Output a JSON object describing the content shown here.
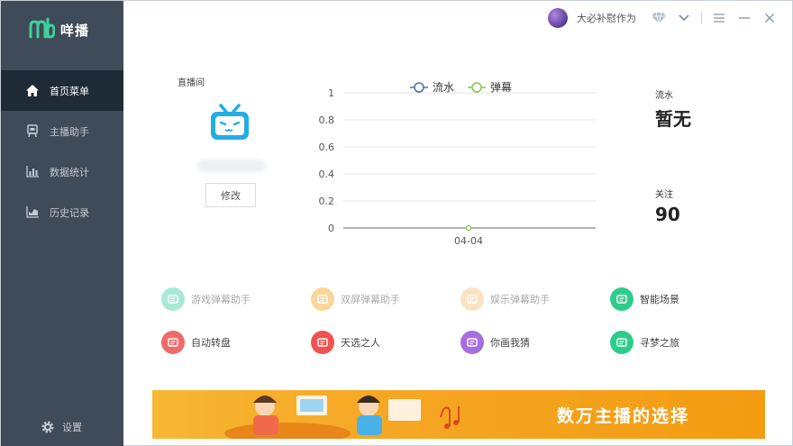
{
  "app": {
    "name": "咩播"
  },
  "nav": [
    {
      "label": "首页菜单",
      "icon": "home-icon",
      "active": true
    },
    {
      "label": "主播助手",
      "icon": "assistant-icon",
      "active": false
    },
    {
      "label": "数据统计",
      "icon": "bar-chart-icon",
      "active": false
    },
    {
      "label": "历史记录",
      "icon": "line-chart-icon",
      "active": false
    }
  ],
  "settings": {
    "label": "设置",
    "icon": "gear-icon"
  },
  "topbar": {
    "username": "大必补慰作为",
    "icons": [
      "avatar",
      "diamond-icon",
      "chevron-down-icon",
      "menu-icon",
      "minimize-icon",
      "close-icon"
    ]
  },
  "room": {
    "label": "直播间",
    "platform_icon": "bilibili-tv-icon",
    "edit_label": "修改"
  },
  "chart_data": {
    "type": "line",
    "x": [
      "04-04"
    ],
    "series": [
      {
        "name": "流水",
        "values": [
          0
        ],
        "color": "#4a6fa5"
      },
      {
        "name": "弹幕",
        "values": [
          0
        ],
        "color": "#8bc34a"
      }
    ],
    "yticks": [
      "1",
      "0.8",
      "0.6",
      "0.4",
      "0.2",
      "0"
    ],
    "ylim": [
      0,
      1
    ],
    "legend": "top-center",
    "grid": true
  },
  "stats": {
    "flow": {
      "label": "流水",
      "value": "暂无"
    },
    "follow": {
      "label": "关注",
      "value": "90"
    }
  },
  "tools": [
    {
      "label": "游戏弹幕助手",
      "icon": "game-danmaku-icon",
      "color": "#3fcfa5",
      "enabled": false
    },
    {
      "label": "双屏弹幕助手",
      "icon": "dual-screen-icon",
      "color": "#f5a623",
      "enabled": false
    },
    {
      "label": "娱乐弹幕助手",
      "icon": "entertainment-icon",
      "color": "#f5c27a",
      "enabled": false
    },
    {
      "label": "智能场景",
      "icon": "smart-scene-icon",
      "color": "#2ecc8a",
      "enabled": true
    },
    {
      "label": "自动转盘",
      "icon": "wheel-icon",
      "color": "#f06a6a",
      "enabled": true
    },
    {
      "label": "天选之人",
      "icon": "chosen-icon",
      "color": "#f0524e",
      "enabled": true
    },
    {
      "label": "你画我猜",
      "icon": "draw-guess-icon",
      "color": "#a66ee0",
      "enabled": true
    },
    {
      "label": "寻梦之旅",
      "icon": "dream-trip-icon",
      "color": "#2ecc8a",
      "enabled": true
    }
  ],
  "banner": {
    "text": "数万主播的选择"
  }
}
